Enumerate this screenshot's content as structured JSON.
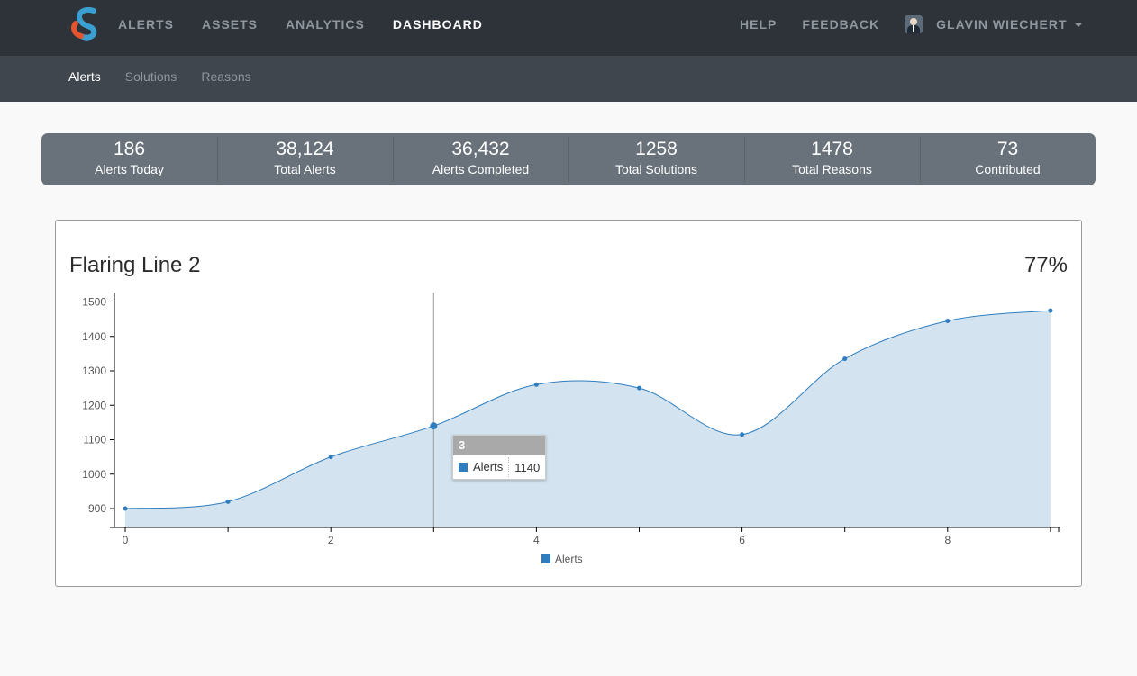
{
  "nav": {
    "left": [
      "Alerts",
      "Assets",
      "Analytics",
      "Dashboard"
    ],
    "active": "Dashboard",
    "right": [
      "Help",
      "Feedback"
    ],
    "user": "Glavin Wiechert"
  },
  "subnav": {
    "items": [
      "Alerts",
      "Solutions",
      "Reasons"
    ],
    "active": "Alerts"
  },
  "stats": [
    {
      "value": "186",
      "label": "Alerts Today"
    },
    {
      "value": "38,124",
      "label": "Total Alerts"
    },
    {
      "value": "36,432",
      "label": "Alerts Completed"
    },
    {
      "value": "1258",
      "label": "Total Solutions"
    },
    {
      "value": "1478",
      "label": "Total Reasons"
    },
    {
      "value": "73",
      "label": "Contributed"
    }
  ],
  "card": {
    "title": "Flaring Line 2",
    "percent": "77%"
  },
  "tooltip": {
    "header": "3",
    "series": "Alerts",
    "value": "1140"
  },
  "colors": {
    "series": "#2f7dbe",
    "area": "#d3e4f0"
  },
  "chart_data": {
    "type": "area",
    "x": [
      0,
      1,
      2,
      3,
      4,
      5,
      6,
      7,
      8,
      9
    ],
    "series": [
      {
        "name": "Alerts",
        "values": [
          900,
          920,
          1050,
          1140,
          1260,
          1250,
          1115,
          1335,
          1445,
          1475
        ]
      }
    ],
    "xticks": [
      0,
      2,
      4,
      6,
      8
    ],
    "yticks": [
      900,
      1000,
      1100,
      1200,
      1300,
      1400,
      1500
    ],
    "highlight_x": 3,
    "legend": "bottom-center"
  }
}
